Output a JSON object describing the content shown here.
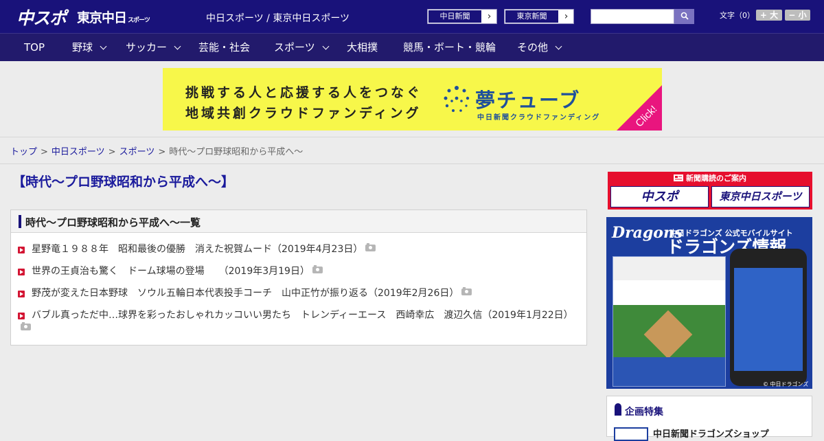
{
  "header": {
    "logo_chuspo": "中スポ",
    "logo_tokyo": "東京中日",
    "logo_tokyo_suffix": "スポーツ",
    "title": "中日スポーツ / 東京中日スポーツ",
    "paper_chunichi": "中日新聞",
    "paper_tokyo": "東京新聞",
    "search_placeholder": "",
    "font_label": "文字（0）",
    "font_large": "+ 大",
    "font_small": "− 小",
    "colors": {
      "bg": "#19127a",
      "nav": "#221a6c"
    }
  },
  "nav": {
    "items": [
      {
        "label": "TOP",
        "dropdown": false
      },
      {
        "label": "野球",
        "dropdown": true
      },
      {
        "label": "サッカー",
        "dropdown": true
      },
      {
        "label": "芸能・社会",
        "dropdown": false
      },
      {
        "label": "スポーツ",
        "dropdown": true
      },
      {
        "label": "大相撲",
        "dropdown": false
      },
      {
        "label": "競馬・ボート・競輪",
        "dropdown": false
      },
      {
        "label": "その他",
        "dropdown": true
      }
    ]
  },
  "banner": {
    "line1": "挑戦する人と応援する人をつなぐ",
    "line2": "地域共創クラウドファンディング",
    "brand": "夢チューブ",
    "sub": "中日新聞クラウドファンディング",
    "click": "Click!"
  },
  "breadcrumb": {
    "items": [
      "トップ",
      "中日スポーツ",
      "スポーツ"
    ],
    "current": "時代～プロ野球昭和から平成へ～",
    "separator": ">"
  },
  "main": {
    "page_title": "【時代～プロ野球昭和から平成へ～】",
    "list_title": "時代～プロ野球昭和から平成へ～一覧",
    "articles": [
      {
        "title": "星野竜１９８８年　昭和最後の優勝　消えた祝賀ムード",
        "date": "（2019年4月23日）",
        "photo": true
      },
      {
        "title": "世界の王貞治も驚く　ドーム球場の登場　　",
        "date": "（2019年3月19日）",
        "photo": true
      },
      {
        "title": "野茂が変えた日本野球　ソウル五輪日本代表投手コーチ　山中正竹が振り返る",
        "date": "（2019年2月26日）",
        "photo": true
      },
      {
        "title": "バブル真っただ中…球界を彩ったおしゃれカッコいい男たち　トレンディーエース　西崎幸広　渡辺久信",
        "date": "（2019年1月22日）",
        "photo": true
      }
    ]
  },
  "sidebar": {
    "subscribe_title": "新聞購読のご案内",
    "subscribe_chuspo": "中スポ",
    "subscribe_tokyo": "東京中日スポーツ",
    "dragons_logo": "Dragons",
    "dragons_sub": "中日ドラゴンズ 公式モバイルサイト",
    "dragons_title": "ドラゴンズ情報",
    "dragons_copy": "© 中日ドラゴンズ",
    "feature_title": "企画特集",
    "feature_item": "中日新聞ドラゴンズショップ"
  }
}
